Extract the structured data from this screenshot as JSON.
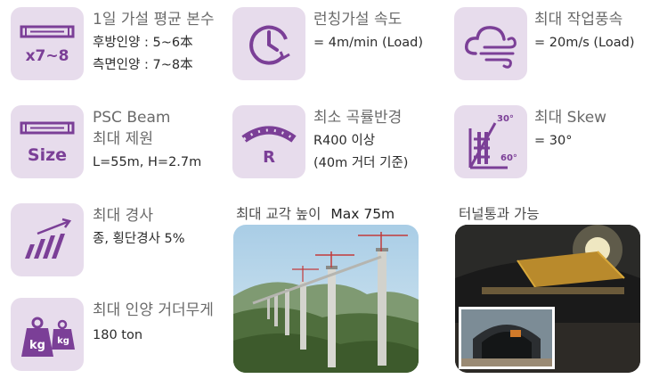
{
  "colors": {
    "accent": "#7b3f97",
    "tile_bg": "#e7dcec",
    "title": "#6a6a6a",
    "value": "#2b2b2b"
  },
  "specs": [
    {
      "icon": "beam-count-icon",
      "icon_text": "x7~8",
      "title": "1일 가설 평균 본수",
      "lines": [
        "후방인양 : 5~6本",
        "측면인양 : 7~8本"
      ]
    },
    {
      "icon": "clock-icon",
      "title": "런칭가설 속도",
      "lines": [
        "= 4m/min (Load)"
      ]
    },
    {
      "icon": "wind-cloud-icon",
      "title": "최대 작업풍속",
      "lines": [
        "= 20m/s (Load)"
      ]
    },
    {
      "icon": "beam-size-icon",
      "icon_text": "Size",
      "title": "PSC Beam",
      "title2": "최대 제원",
      "lines": [
        "L=55m, H=2.7m"
      ]
    },
    {
      "icon": "curve-radius-icon",
      "icon_text": "R",
      "title": "최소 곡률반경",
      "lines": [
        "R400 이상",
        "(40m 거더 기준)"
      ]
    },
    {
      "icon": "skew-angle-icon",
      "icon_text_top": "30°",
      "icon_text_bottom": "60°",
      "title": "최대 Skew",
      "lines": [
        "= 30°"
      ]
    },
    {
      "icon": "slope-icon",
      "title": "최대 경사",
      "lines": [
        "종, 횡단경사 5%"
      ]
    },
    {
      "icon": "weight-icon",
      "icon_text_1": "kg",
      "icon_text_2": "kg",
      "title": "최대 인양 거더무게",
      "lines": [
        "180 ton"
      ]
    }
  ],
  "photos": {
    "bridge": {
      "caption": "최대 교각 높이",
      "caption_value": "Max 75m"
    },
    "tunnel": {
      "caption": "터널통과 가능"
    }
  }
}
